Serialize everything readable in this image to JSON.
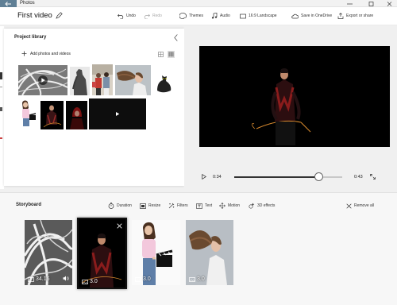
{
  "window": {
    "app_title": "Photos",
    "back_icon": "back-arrow-icon",
    "controls": [
      "minimize-icon",
      "maximize-icon",
      "close-icon"
    ]
  },
  "header": {
    "video_title": "First video",
    "rename_icon": "pencil-icon",
    "toolbar": {
      "undo": "Undo",
      "redo": "Redo",
      "themes": "Themes",
      "audio": "Audio",
      "aspect": "16:9 Landscape",
      "save_onedrive": "Save in OneDrive",
      "export": "Export or share"
    }
  },
  "library": {
    "title": "Project library",
    "add_label": "Add photos and videos",
    "view_icons": [
      "grid-small-icon",
      "grid-large-icon"
    ],
    "items": [
      {
        "kind": "video",
        "name": "white-hair-video"
      },
      {
        "kind": "photo",
        "name": "dark-figure-photo"
      },
      {
        "kind": "photo",
        "name": "shoppers-photo"
      },
      {
        "kind": "photo",
        "name": "hair-toss-photo"
      },
      {
        "kind": "photo",
        "name": "black-cat-photo"
      },
      {
        "kind": "photo",
        "name": "clapboard-woman-photo"
      },
      {
        "kind": "photo",
        "name": "archer-photo"
      },
      {
        "kind": "photo",
        "name": "red-hood-photo"
      },
      {
        "kind": "video",
        "name": "black-clip-video"
      }
    ]
  },
  "preview": {
    "current_time": "0:34",
    "end_time": "0:43",
    "progress": 0.78
  },
  "storyboard": {
    "title": "Storyboard",
    "tools": {
      "duration": "Duration",
      "resize": "Resize",
      "filters": "Filters",
      "text": "Text",
      "motion": "Motion",
      "effects_3d": "3D effects",
      "remove_all": "Remove all"
    },
    "cards": [
      {
        "duration": "34.16",
        "kind": "video",
        "selected": false
      },
      {
        "duration": "3.0",
        "kind": "photo",
        "selected": true
      },
      {
        "duration": "3.0",
        "kind": "photo",
        "selected": false
      },
      {
        "duration": "3.0",
        "kind": "photo",
        "selected": false
      }
    ]
  },
  "colors": {
    "accent_back": "#5f7f95",
    "panel": "#ffffff",
    "background": "#f0f0f0",
    "video_bg": "#000000"
  }
}
